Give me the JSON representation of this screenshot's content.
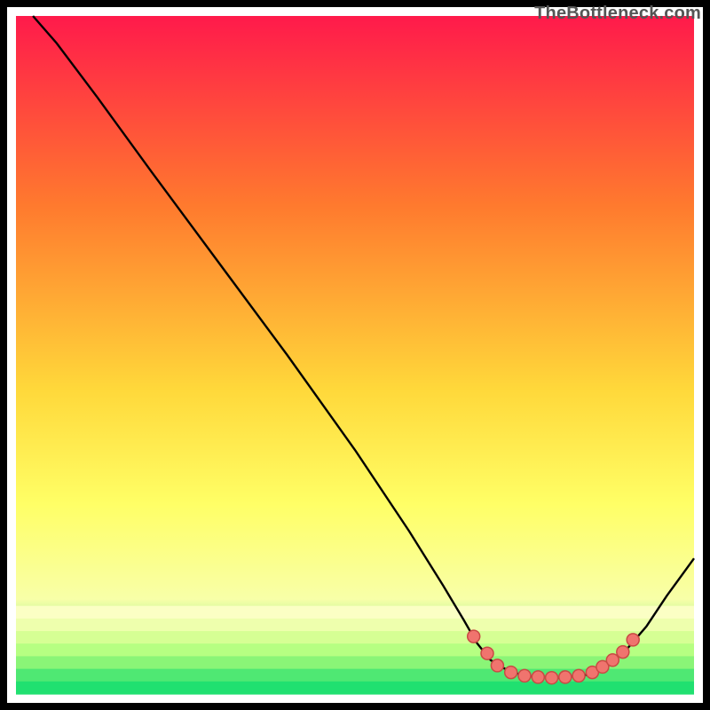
{
  "watermark": "TheBottleneck.com",
  "colors": {
    "gradient_top": "#ff1a4b",
    "gradient_mid1": "#ff7a2e",
    "gradient_mid2": "#ffd83a",
    "gradient_mid3": "#ffff66",
    "gradient_band": "#f8ffa8",
    "gradient_green": "#20e070",
    "curve": "#000000",
    "dot_fill": "#f0746e",
    "dot_stroke": "#c94a44",
    "frame": "#000000"
  },
  "chart_data": {
    "type": "line",
    "title": "",
    "xlabel": "",
    "ylabel": "",
    "xlim": [
      0,
      100
    ],
    "ylim": [
      0,
      100
    ],
    "curve_points": [
      {
        "x": 2.5,
        "y": 100
      },
      {
        "x": 6,
        "y": 96
      },
      {
        "x": 12,
        "y": 88
      },
      {
        "x": 20,
        "y": 77
      },
      {
        "x": 30,
        "y": 63.5
      },
      {
        "x": 40,
        "y": 50
      },
      {
        "x": 50,
        "y": 36
      },
      {
        "x": 58,
        "y": 24
      },
      {
        "x": 63,
        "y": 16
      },
      {
        "x": 66,
        "y": 11
      },
      {
        "x": 68,
        "y": 7.5
      },
      {
        "x": 70,
        "y": 5
      },
      {
        "x": 73,
        "y": 3.2
      },
      {
        "x": 76,
        "y": 2.6
      },
      {
        "x": 80,
        "y": 2.4
      },
      {
        "x": 84,
        "y": 2.8
      },
      {
        "x": 87,
        "y": 4
      },
      {
        "x": 90,
        "y": 6.5
      },
      {
        "x": 93,
        "y": 10
      },
      {
        "x": 96,
        "y": 14.5
      },
      {
        "x": 100,
        "y": 20
      }
    ],
    "dots": [
      {
        "x": 67.5,
        "y": 8.5
      },
      {
        "x": 69.5,
        "y": 6
      },
      {
        "x": 71,
        "y": 4.2
      },
      {
        "x": 73,
        "y": 3.2
      },
      {
        "x": 75,
        "y": 2.7
      },
      {
        "x": 77,
        "y": 2.5
      },
      {
        "x": 79,
        "y": 2.4
      },
      {
        "x": 81,
        "y": 2.5
      },
      {
        "x": 83,
        "y": 2.7
      },
      {
        "x": 85,
        "y": 3.2
      },
      {
        "x": 86.5,
        "y": 4
      },
      {
        "x": 88,
        "y": 5
      },
      {
        "x": 89.5,
        "y": 6.2
      },
      {
        "x": 91,
        "y": 8
      }
    ]
  }
}
